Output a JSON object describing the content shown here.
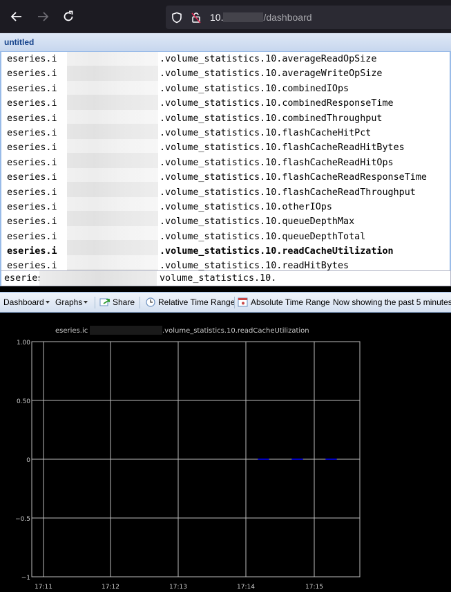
{
  "browser": {
    "url_host": "10.",
    "url_path": "/dashboard"
  },
  "panel": {
    "title": "untitled"
  },
  "metrics": {
    "prefix": "eseries.i",
    "items": [
      ".volume_statistics.10.averageReadOpSize",
      ".volume_statistics.10.averageWriteOpSize",
      ".volume_statistics.10.combinedIOps",
      ".volume_statistics.10.combinedResponseTime",
      ".volume_statistics.10.combinedThroughput",
      ".volume_statistics.10.flashCacheHitPct",
      ".volume_statistics.10.flashCacheReadHitBytes",
      ".volume_statistics.10.flashCacheReadHitOps",
      ".volume_statistics.10.flashCacheReadResponseTime",
      ".volume_statistics.10.flashCacheReadThroughput",
      ".volume_statistics.10.otherIOps",
      ".volume_statistics.10.queueDepthMax",
      ".volume_statistics.10.queueDepthTotal",
      ".volume_statistics.10.readCacheUtilization",
      ".volume_statistics.10.readHitBytes"
    ],
    "selected_index": 13
  },
  "path_input": {
    "prefix": "eseries.i",
    "suffix": "volume_statistics.10."
  },
  "toolbar": {
    "dashboard_label": "Dashboard",
    "graphs_label": "Graphs",
    "share_label": "Share",
    "relative_label": "Relative Time Range",
    "absolute_label": "Absolute Time Range",
    "status_text": "Now showing the past 5 minutes"
  },
  "graph": {
    "title_prefix": "eseries.ic",
    "title_suffix": ".volume_statistics.10.readCacheUtilization"
  },
  "chart_data": {
    "type": "line",
    "title": "eseries.ic .volume_statistics.10.readCacheUtilization",
    "x_ticks": [
      "17:11",
      "17:12",
      "17:13",
      "17:14",
      "17:15"
    ],
    "y_ticks": [
      "1.00",
      "0.50",
      "0",
      "−0.5",
      "−1"
    ],
    "ylim": [
      -1,
      1
    ],
    "grid": true,
    "series": [
      {
        "color": "#0000ff",
        "x": [
          "17:14:10",
          "17:14:20",
          "17:14:40",
          "17:14:50",
          "17:15:10",
          "17:15:20"
        ],
        "values": [
          0,
          0,
          0,
          0,
          0,
          0
        ]
      }
    ]
  }
}
